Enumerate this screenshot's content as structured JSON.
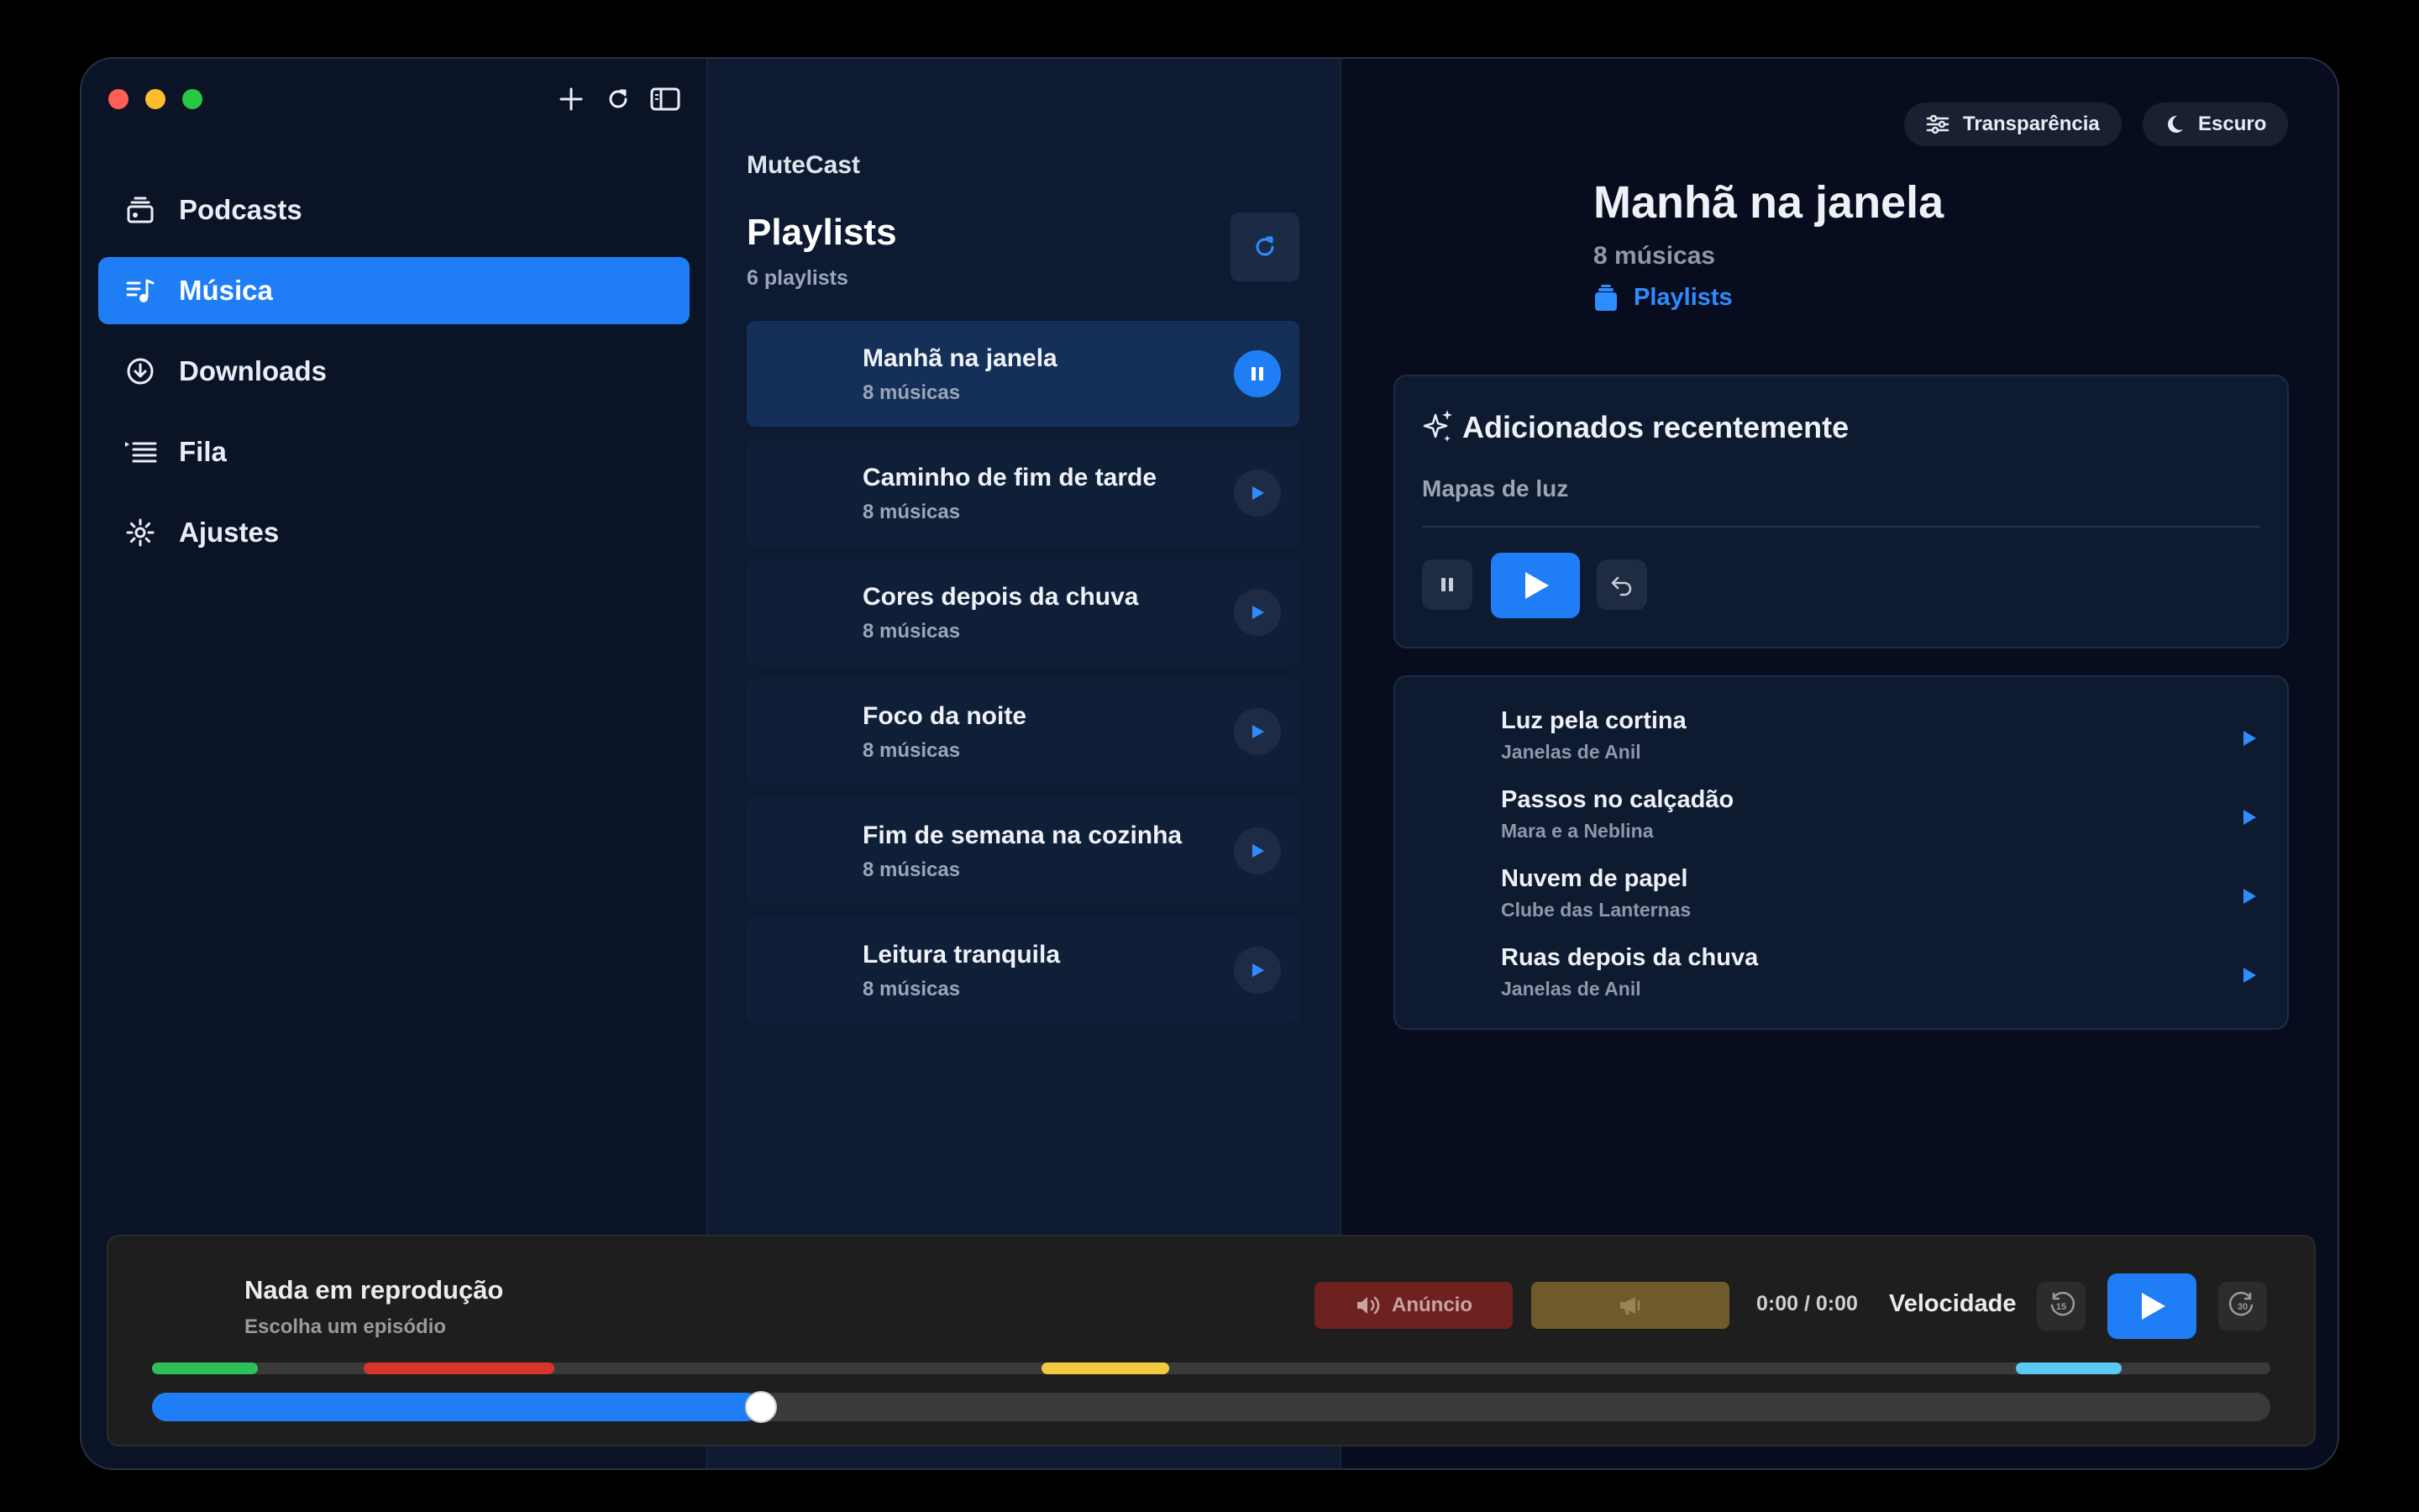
{
  "sidebar": {
    "items": [
      {
        "label": "Podcasts",
        "icon": "podcasts-icon"
      },
      {
        "label": "Música",
        "icon": "music-icon",
        "active": true
      },
      {
        "label": "Downloads",
        "icon": "download-icon"
      },
      {
        "label": "Fila",
        "icon": "queue-icon"
      },
      {
        "label": "Ajustes",
        "icon": "gear-icon"
      }
    ]
  },
  "middle": {
    "brand": "MuteCast",
    "title": "Playlists",
    "count": "6 playlists",
    "playlists": [
      {
        "name": "Manhã na janela",
        "sub": "8 músicas",
        "active": true
      },
      {
        "name": "Caminho de fim de tarde",
        "sub": "8 músicas"
      },
      {
        "name": "Cores depois da chuva",
        "sub": "8 músicas"
      },
      {
        "name": "Foco da noite",
        "sub": "8 músicas"
      },
      {
        "name": "Fim de semana na cozinha",
        "sub": "8 músicas"
      },
      {
        "name": "Leitura tranquila",
        "sub": "8 músicas"
      }
    ]
  },
  "detail": {
    "chip_transparency": "Transparência",
    "chip_theme": "Escuro",
    "title": "Manhã na janela",
    "sub": "8 músicas",
    "link": "Playlists",
    "recent_title": "Adicionados recentemente",
    "recent_song": "Mapas de luz",
    "songs": [
      {
        "name": "Luz pela cortina",
        "artist": "Janelas de Anil"
      },
      {
        "name": "Passos no calçadão",
        "artist": "Mara e a Neblina"
      },
      {
        "name": "Nuvem de papel",
        "artist": "Clube das Lanternas"
      },
      {
        "name": "Ruas depois da chuva",
        "artist": "Janelas de Anil"
      }
    ]
  },
  "player": {
    "title": "Nada em reprodução",
    "sub": "Escolha um episódio",
    "ad_label": "Anúncio",
    "time": "0:00 / 0:00",
    "speed": "Velocidade",
    "skip_back": "15",
    "skip_forward": "30",
    "progress": 0.28,
    "segments": [
      {
        "start": 0.0,
        "end": 0.05,
        "color": "#2fbf5a"
      },
      {
        "start": 0.1,
        "end": 0.19,
        "color": "#d9342b"
      },
      {
        "start": 0.42,
        "end": 0.48,
        "color": "#f5c842"
      },
      {
        "start": 0.88,
        "end": 0.93,
        "color": "#5bc8f5"
      }
    ]
  },
  "colors": {
    "accent": "#1f7ef5"
  }
}
